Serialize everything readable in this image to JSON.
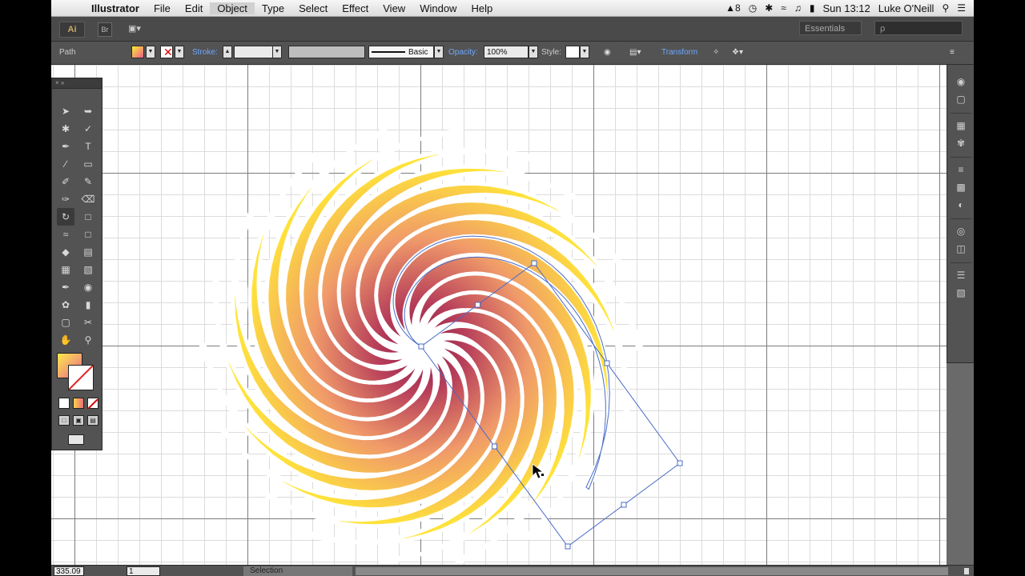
{
  "menubar": {
    "apple_glyph": "",
    "app_name": "Illustrator",
    "items": [
      "File",
      "Edit",
      "Object",
      "Type",
      "Select",
      "Effect",
      "View",
      "Window",
      "Help"
    ],
    "status": {
      "adobe_count": "8",
      "clock": "Sun 13:12",
      "user": "Luke O'Neill"
    }
  },
  "appbar": {
    "logo": "Ai",
    "bridge": "Br",
    "workspace": "Essentials",
    "search_placeholder": "ρ"
  },
  "control_bar": {
    "object_type": "Path",
    "stroke_label": "Stroke:",
    "brush_label": "Basic",
    "opacity_label": "Opacity:",
    "opacity_value": "100%",
    "style_label": "Style:",
    "transform_label": "Transform"
  },
  "status_bar": {
    "zoom": "335.09",
    "page": "1",
    "status_text": "Selection"
  },
  "colors": {
    "gradient_light": "#ffee33",
    "gradient_mid": "#f3a06c",
    "gradient_dark": "#8c1a4a",
    "selection": "#4a6cc8"
  },
  "tools": [
    "selection-tool",
    "direct-selection-tool",
    "magic-wand-tool",
    "lasso-tool",
    "pen-tool",
    "type-tool",
    "line-tool",
    "rectangle-tool",
    "paintbrush-tool",
    "pencil-tool",
    "blob-brush-tool",
    "eraser-tool",
    "rotate-tool",
    "scale-tool",
    "width-tool",
    "free-transform-tool",
    "shape-builder-tool",
    "perspective-grid-tool",
    "mesh-tool",
    "gradient-tool",
    "eyedropper-tool",
    "blend-tool",
    "symbol-sprayer-tool",
    "column-graph-tool",
    "artboard-tool",
    "slice-tool",
    "hand-tool",
    "zoom-tool"
  ]
}
